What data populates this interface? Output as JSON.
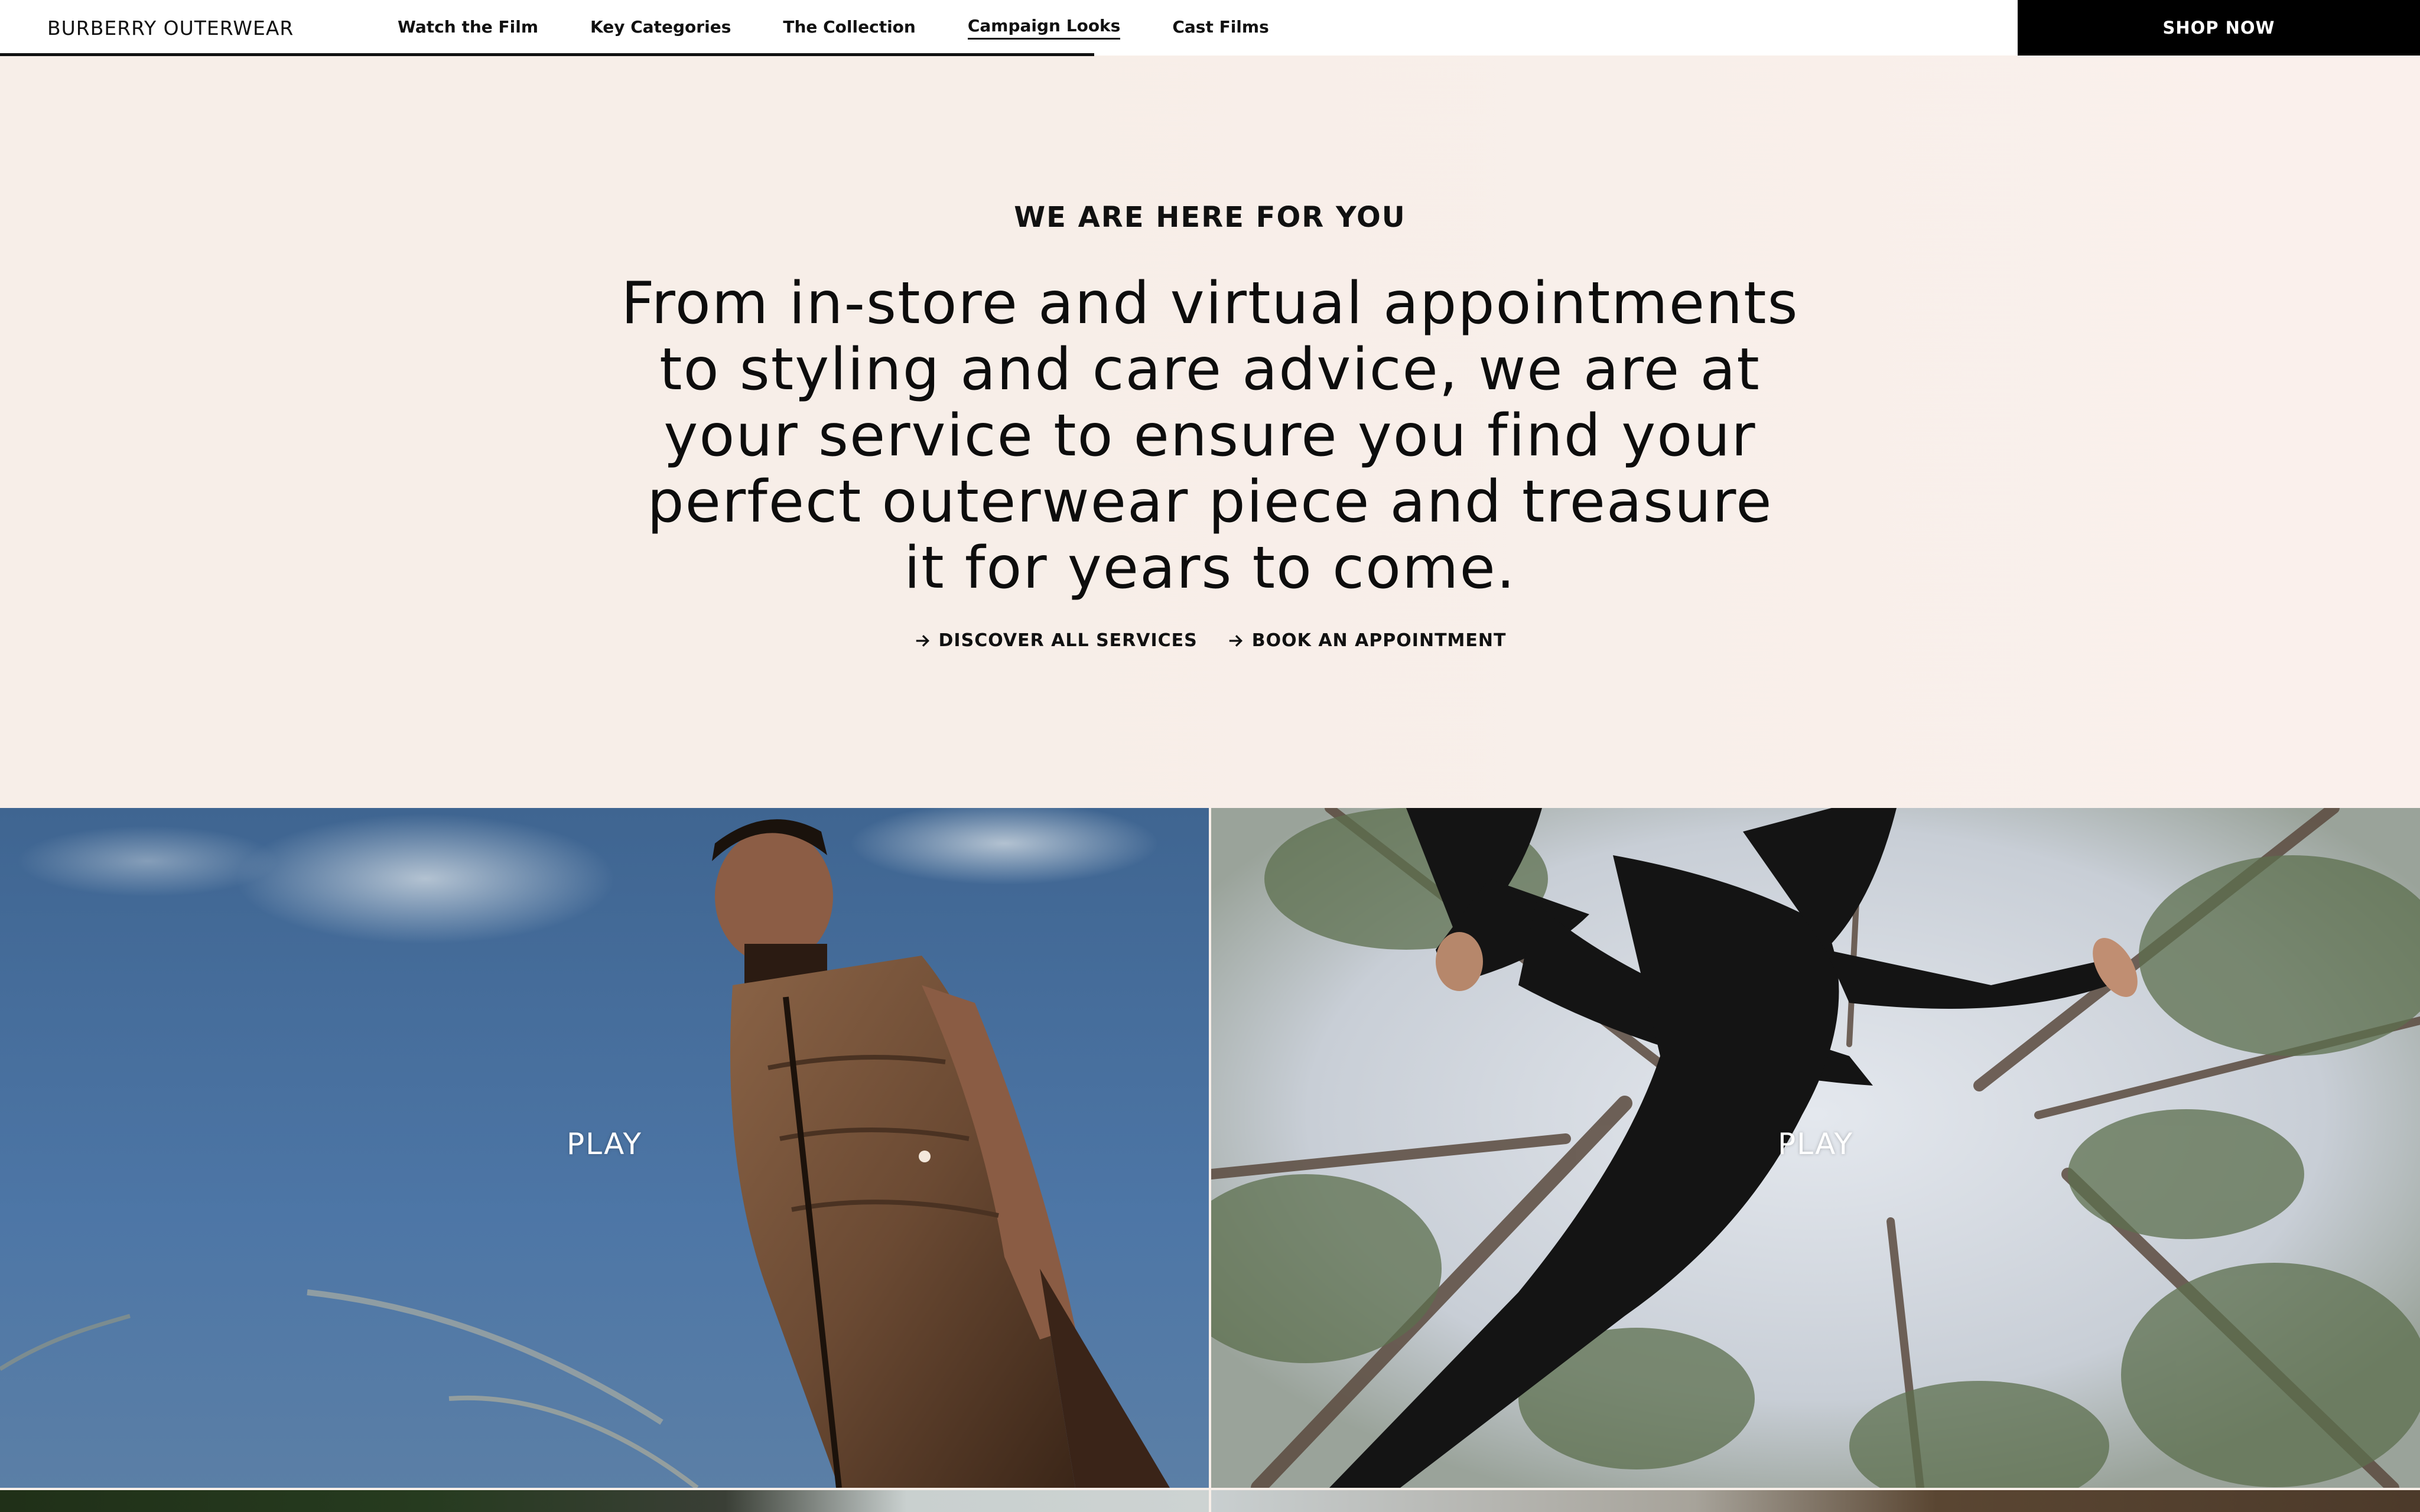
{
  "brand": "BURBERRY OUTERWEAR",
  "nav": {
    "items": [
      {
        "label": "Watch the Film"
      },
      {
        "label": "Key Categories"
      },
      {
        "label": "The Collection"
      },
      {
        "label": "Campaign Looks",
        "active": true
      },
      {
        "label": "Cast Films"
      }
    ],
    "cta": "SHOP NOW"
  },
  "hero": {
    "eyebrow": "WE ARE HERE FOR YOU",
    "statement": "From in-store and virtual appointments to styling and care advice, we are at your service to ensure you find your perfect outerwear piece and treasure it for years to come.",
    "links": [
      {
        "label": "DISCOVER ALL SERVICES",
        "icon": "arrow-right-icon"
      },
      {
        "label": "BOOK AN APPOINTMENT",
        "icon": "arrow-right-icon"
      }
    ]
  },
  "videos": [
    {
      "play_label": "PLAY"
    },
    {
      "play_label": "PLAY"
    }
  ],
  "colors": {
    "background": "#f8efe9",
    "text": "#111111",
    "cta_background": "#000000",
    "cta_text": "#ffffff"
  }
}
